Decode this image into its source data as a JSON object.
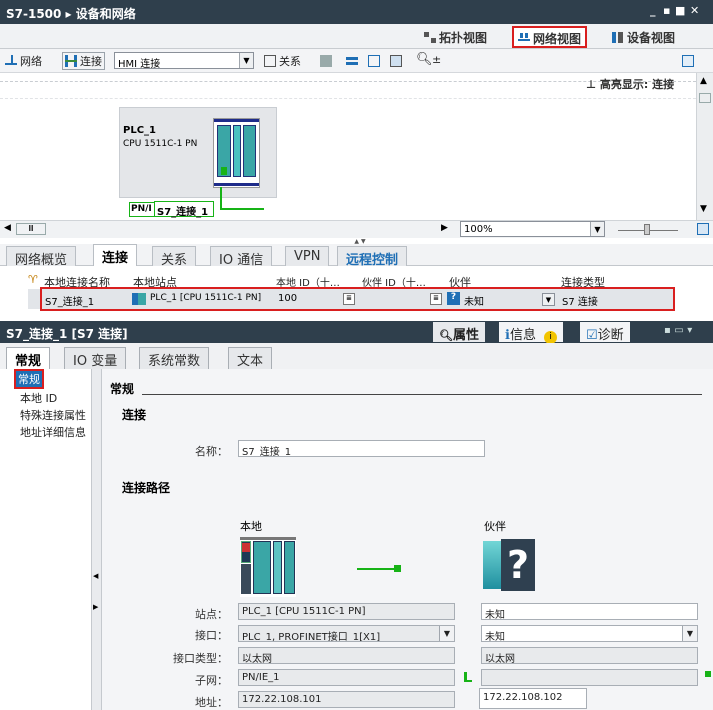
{
  "title": "S7-1500 ▸ 设备和网络",
  "window_buttons": [
    "_",
    "▪",
    "■",
    "✕"
  ],
  "view_tabs": {
    "topology": "拓扑视图",
    "network": "网络视图",
    "device": "设备视图"
  },
  "toolbar": {
    "network": "网络",
    "connect": "连接",
    "connection_type": "HMI 连接",
    "relations": "关系"
  },
  "highlight_label": "高亮显示: 连接",
  "device": {
    "name": "PLC_1",
    "type": "CPU 1511C-1 PN",
    "pn_label": "PN/I",
    "connection_label": "S7_连接_1"
  },
  "zoom": "100%",
  "bottom_tabs": [
    "网络概览",
    "连接",
    "关系",
    "IO 通信",
    "VPN",
    "远程控制"
  ],
  "grid": {
    "headers": [
      "本地连接名称",
      "本地站点",
      "本地 ID（十…",
      "伙伴 ID（十…",
      "伙伴",
      "连接类型"
    ],
    "row": {
      "name": "S7_连接_1",
      "station": "PLC_1 [CPU 1511C-1 PN]",
      "local_id": "100",
      "partner_id": "",
      "partner": "未知",
      "type": "S7 连接"
    }
  },
  "props": {
    "title": "S7_连接_1 [S7 连接]",
    "tabs": [
      "属性",
      "信息",
      "诊断"
    ],
    "sub_tabs": [
      "常规",
      "IO 变量",
      "系统常数",
      "文本"
    ],
    "nav": [
      "常规",
      "本地 ID",
      "特殊连接属性",
      "地址详细信息"
    ]
  },
  "general": {
    "section": "常规",
    "connection_heading": "连接",
    "name_label": "名称：",
    "name_value": "S7_连接_1",
    "path_heading": "连接路径",
    "local_heading": "本地",
    "partner_heading": "伙伴",
    "rows": [
      {
        "label": "站点：",
        "local": "PLC_1 [CPU 1511C-1 PN]",
        "partner": "未知"
      },
      {
        "label": "接口：",
        "local": "PLC_1, PROFINET接口_1[X1]",
        "partner": "未知"
      },
      {
        "label": "接口类型：",
        "local": "以太网",
        "partner": "以太网"
      },
      {
        "label": "子网：",
        "local": "PN/IE_1",
        "partner": ""
      },
      {
        "label": "地址：",
        "local": "172.22.108.101",
        "partner": "172.22.108.102"
      }
    ]
  },
  "colors": {
    "accent_red": "#d91f1f",
    "dark_bar": "#2f3f4c",
    "teal": "#3aa6a6",
    "green": "#17b317"
  }
}
